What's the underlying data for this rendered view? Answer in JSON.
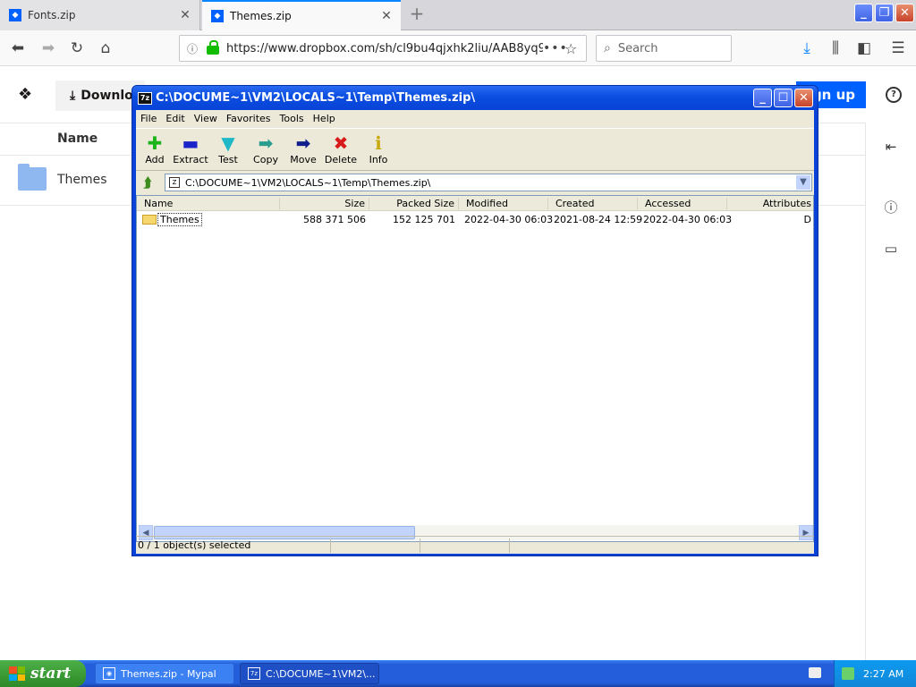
{
  "browser": {
    "tabs": [
      {
        "label": "Fonts.zip",
        "active": false
      },
      {
        "label": "Themes.zip",
        "active": true
      }
    ],
    "url": "https://www.dropbox.com/sh/cl9bu4qjxhk2liu/AAB8yq9",
    "search_placeholder": "Search"
  },
  "dropbox": {
    "download_label": "Downlo",
    "signup_label": "ign up",
    "column_name": "Name",
    "rows": [
      {
        "name": "Themes"
      }
    ]
  },
  "sevenzip": {
    "title": "C:\\DOCUME~1\\VM2\\LOCALS~1\\Temp\\Themes.zip\\",
    "menu": [
      "File",
      "Edit",
      "View",
      "Favorites",
      "Tools",
      "Help"
    ],
    "toolbar": [
      {
        "label": "Add",
        "icon": "plus-icon",
        "color": "#1bb51b",
        "glyph": "✚"
      },
      {
        "label": "Extract",
        "icon": "minus-icon",
        "color": "#1a24c9",
        "glyph": "▬"
      },
      {
        "label": "Test",
        "icon": "test-icon",
        "color": "#1fb8c7",
        "glyph": "▼"
      },
      {
        "label": "Copy",
        "icon": "copy-arrow-icon",
        "color": "#2a9d8f",
        "glyph": "➡"
      },
      {
        "label": "Move",
        "icon": "move-arrow-icon",
        "color": "#101f8c",
        "glyph": "➡"
      },
      {
        "label": "Delete",
        "icon": "delete-x-icon",
        "color": "#d91a1a",
        "glyph": "✖"
      },
      {
        "label": "Info",
        "icon": "info-icon",
        "color": "#c9a80a",
        "glyph": "ℹ"
      }
    ],
    "address": "C:\\DOCUME~1\\VM2\\LOCALS~1\\Temp\\Themes.zip\\",
    "columns": [
      "Name",
      "Size",
      "Packed Size",
      "Modified",
      "Created",
      "Accessed",
      "Attributes"
    ],
    "rows": [
      {
        "name": "Themes",
        "size": "588 371 506",
        "packed_size": "152 125 701",
        "modified": "2022-04-30 06:03",
        "created": "2021-08-24 12:59",
        "accessed": "2022-04-30 06:03",
        "attributes": "D"
      }
    ],
    "status": "0 / 1 object(s) selected"
  },
  "taskbar": {
    "start_label": "start",
    "tasks": [
      {
        "label": "Themes.zip - Mypal"
      },
      {
        "label": "C:\\DOCUME~1\\VM2\\..."
      }
    ],
    "clock": "2:27 AM"
  },
  "colors": {
    "xp_blue": "#245edb",
    "dropbox_blue": "#0061fe",
    "start_green": "#3c9c35"
  }
}
